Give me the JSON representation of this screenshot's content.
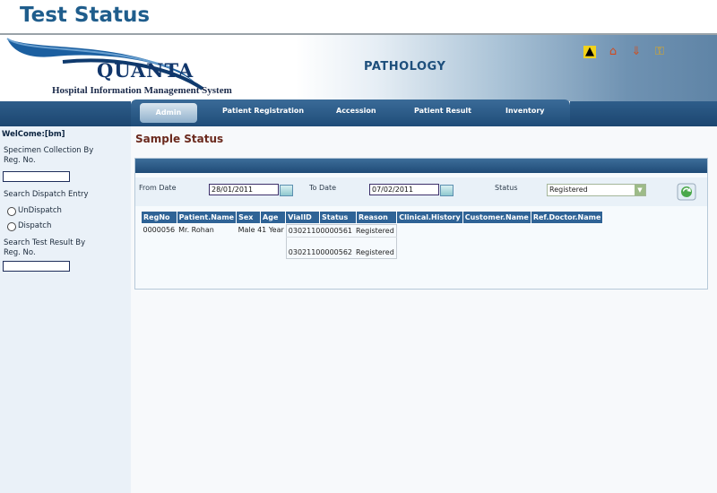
{
  "page_title": "Test Status",
  "logo": {
    "brand": "QUANTA",
    "subtitle": "Hospital Information Management System"
  },
  "module_title": "PATHOLOGY",
  "top_icons": [
    "up-arrow-icon",
    "home-icon",
    "download-icon",
    "key-icon"
  ],
  "nav": {
    "items": [
      "Admin",
      "Patient Registration",
      "Accession",
      "Patient Result",
      "Inventory"
    ],
    "active": "Admin"
  },
  "sidebar": {
    "welcome": "WelCome:[bm]",
    "specimen_label": "Specimen Collection By Reg. No.",
    "dispatch_label": "Search Dispatch Entry",
    "undispatch": "UnDispatch",
    "dispatch": "Dispatch",
    "test_result_label": "Search Test Result By Reg. No."
  },
  "section_title": "Sample Status",
  "filters": {
    "from_label": "From Date",
    "from_value": "28/01/2011",
    "to_label": "To Date",
    "to_value": "07/02/2011",
    "status_label": "Status",
    "status_value": "Registered"
  },
  "table": {
    "columns": [
      "RegNo",
      "Patient.Name",
      "Sex",
      "Age",
      "VialID",
      "Status",
      "Reason",
      "Clinical.History",
      "Customer.Name",
      "Ref.Doctor.Name"
    ],
    "rows": [
      {
        "regno": "0000056",
        "patient": "Mr. Rohan",
        "sex": "Male",
        "age": "41 Year",
        "vials": [
          {
            "vial": "03021100000561",
            "status": "Registered"
          },
          {
            "vial": "03021100000562",
            "status": "Registered"
          }
        ]
      }
    ]
  },
  "colors": {
    "heading": "#1f5d8c",
    "nav": "#1d4a76",
    "section_title": "#6b2a1e",
    "table_header": "#2f6396"
  }
}
